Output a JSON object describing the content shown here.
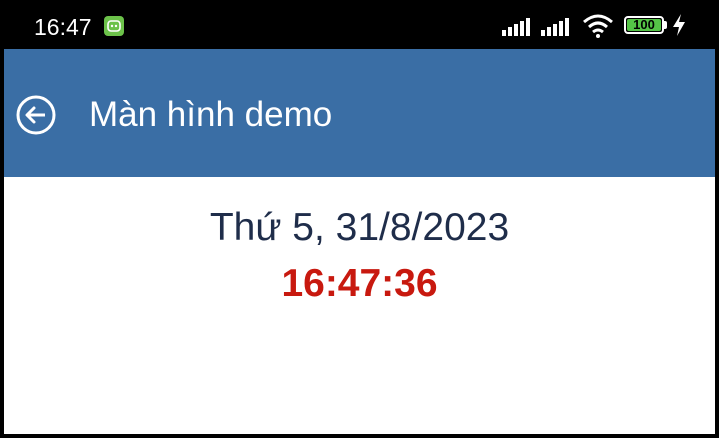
{
  "status_bar": {
    "time": "16:47",
    "battery": "100",
    "icons": [
      "notification-app-icon",
      "signal-icon",
      "signal-icon",
      "wifi-icon",
      "battery-icon",
      "charging-bolt-icon"
    ]
  },
  "app_bar": {
    "title": "Màn hình demo",
    "back_icon": "back-arrow-icon",
    "background_color": "#3a6ea5"
  },
  "content": {
    "date": "Thứ 5, 31/8/2023",
    "clock": "16:47:36",
    "date_color": "#1f2d4a",
    "clock_color": "#c8190f"
  }
}
